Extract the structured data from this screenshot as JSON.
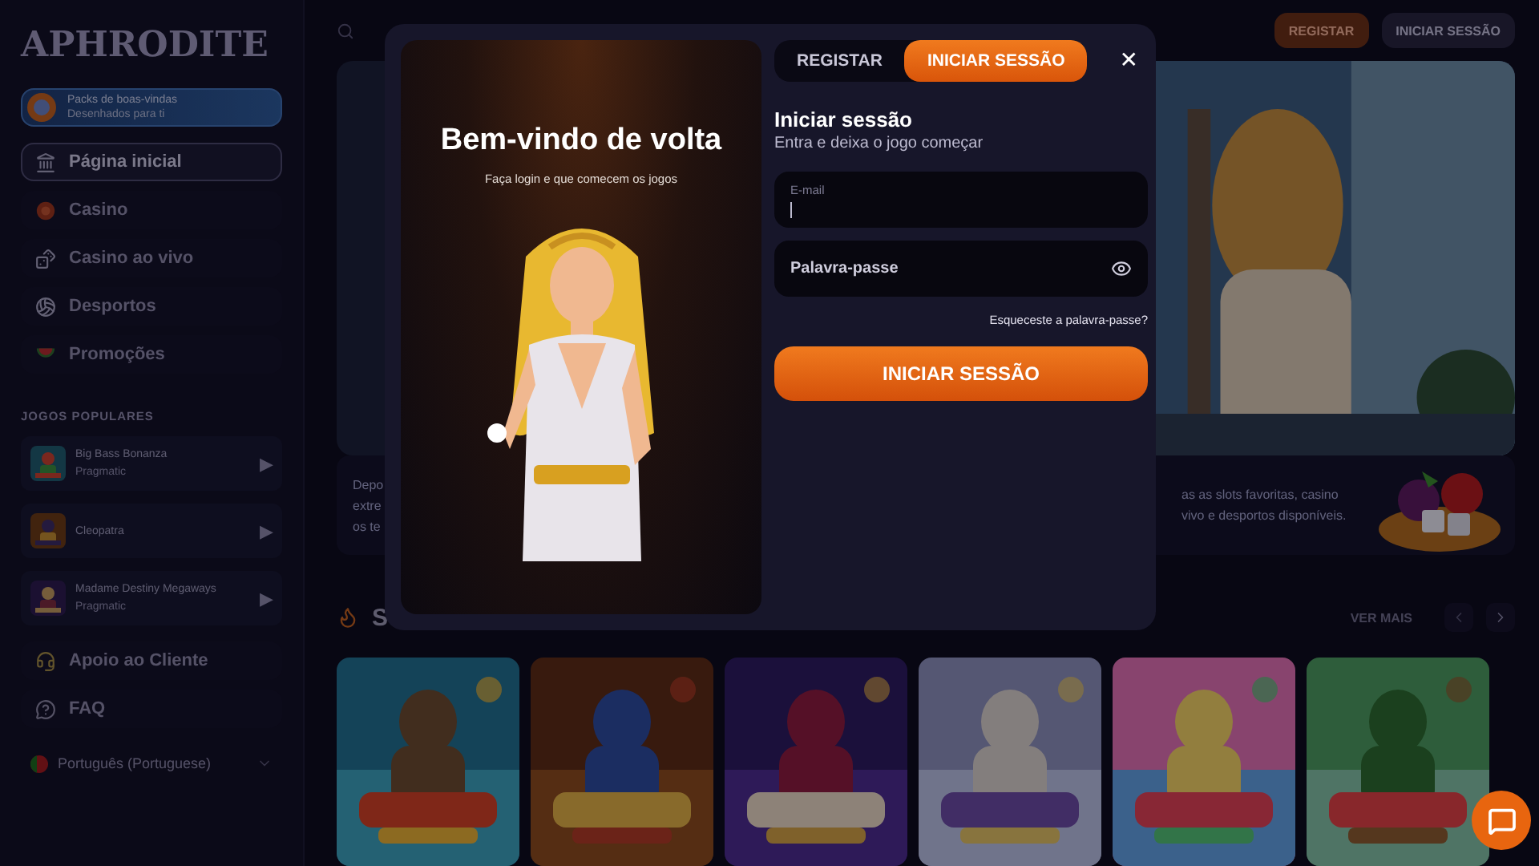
{
  "sidebar": {
    "logo": "APHRODITE",
    "promo": {
      "title": "Packs de boas-vindas",
      "subtitle": "Desenhados para ti"
    },
    "nav": [
      {
        "label": "Página inicial",
        "selected": true
      },
      {
        "label": "Casino",
        "selected": false
      },
      {
        "label": "Casino ao vivo",
        "selected": false
      },
      {
        "label": "Desportos",
        "selected": false
      },
      {
        "label": "Promoções",
        "selected": false
      }
    ],
    "popular_heading": "JOGOS POPULARES",
    "popular_games": [
      {
        "name": "Big Bass Bonanza",
        "provider": "Pragmatic",
        "play": "▶"
      },
      {
        "name": "Cleopatra",
        "play": "▶"
      },
      {
        "name": "Madame Destiny Megaways",
        "provider": "Pragmatic",
        "play": "▶"
      }
    ],
    "support": [
      {
        "label": "Apoio ao Cliente"
      },
      {
        "label": "FAQ"
      }
    ],
    "language": {
      "label": "Português (Portuguese)"
    }
  },
  "header": {
    "buttons": [
      {
        "label": "REGISTAR",
        "kind": "primary"
      },
      {
        "label": "INICIAR SESSÃO",
        "kind": "secondary"
      }
    ]
  },
  "banner": {
    "left_lines": [
      "Depo",
      "extre",
      "os te"
    ],
    "right_lines": [
      "as as slots favoritas, casino",
      "vivo e desportos disponíveis."
    ]
  },
  "section": {
    "title": "S",
    "more": "VER MAIS"
  },
  "modal": {
    "welcome_title": "Bem-vindo de volta",
    "welcome_subtitle": "Faça login e que comecem os jogos",
    "tabs": [
      {
        "label": "REGISTAR",
        "selected": false
      },
      {
        "label": "INICIAR SESSÃO",
        "selected": true
      }
    ],
    "close": "✕",
    "heading": "Iniciar sessão",
    "subheading": "Entra e deixa o jogo começar",
    "email": {
      "label": "E-mail",
      "focused": true
    },
    "password": {
      "placeholder": "Palavra-passe"
    },
    "forgot": "Esqueceste a palavra-passe?",
    "submit": "INICIAR SESSÃO"
  }
}
